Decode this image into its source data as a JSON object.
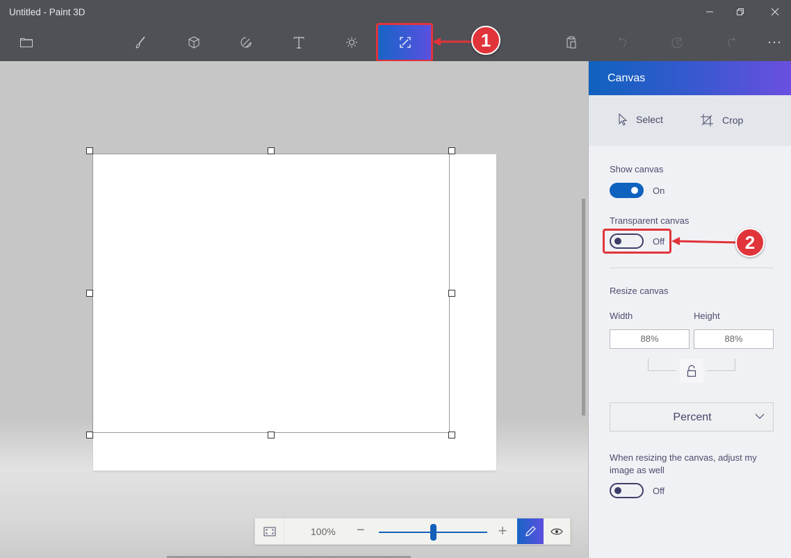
{
  "window": {
    "title": "Untitled - Paint 3D",
    "controls": [
      "minimize",
      "restore",
      "close"
    ]
  },
  "toolbar": {
    "left": [
      {
        "icon": "folder-icon",
        "label": "Menu"
      }
    ],
    "tools": [
      {
        "icon": "brush-icon",
        "label": "Brushes"
      },
      {
        "icon": "cube-icon",
        "label": "3D shapes"
      },
      {
        "icon": "sticker-icon",
        "label": "2D shapes"
      },
      {
        "icon": "text-icon",
        "label": "Text"
      },
      {
        "icon": "effects-icon",
        "label": "Effects"
      },
      {
        "icon": "canvas-icon",
        "label": "Canvas",
        "active": true
      }
    ],
    "right": [
      {
        "icon": "paste-icon",
        "label": "Paste"
      },
      {
        "icon": "undo-icon",
        "label": "Undo",
        "disabled": true
      },
      {
        "icon": "history-icon",
        "label": "History",
        "disabled": true
      },
      {
        "icon": "redo-icon",
        "label": "Redo",
        "disabled": true
      },
      {
        "icon": "more-icon",
        "label": "More"
      }
    ]
  },
  "annotations": [
    {
      "number": "1",
      "color": "#e0343a"
    },
    {
      "number": "2",
      "color": "#e0343a"
    }
  ],
  "panel": {
    "title": "Canvas",
    "tools": [
      {
        "icon": "cursor-icon",
        "label": "Select"
      },
      {
        "icon": "crop-icon",
        "label": "Crop"
      }
    ],
    "show_canvas": {
      "label": "Show canvas",
      "state": "On",
      "value": true
    },
    "transparent_canvas": {
      "label": "Transparent canvas",
      "state": "Off",
      "value": false
    },
    "resize": {
      "label": "Resize canvas",
      "width_label": "Width",
      "height_label": "Height",
      "width_value": "88%",
      "height_value": "88%",
      "lock": "unlocked"
    },
    "unit_dropdown": {
      "selected": "Percent"
    },
    "adjust_image": {
      "label": "When resizing the canvas, adjust my image as well",
      "state": "Off",
      "value": false
    }
  },
  "zoom": {
    "level_label": "100%",
    "minus": "−",
    "plus": "+",
    "slider_fraction": 0.5
  },
  "colors": {
    "accent_start": "#1864c6",
    "accent_end": "#5b50e0",
    "toggle_on": "#0f62be",
    "annotation": "#e0343a"
  }
}
